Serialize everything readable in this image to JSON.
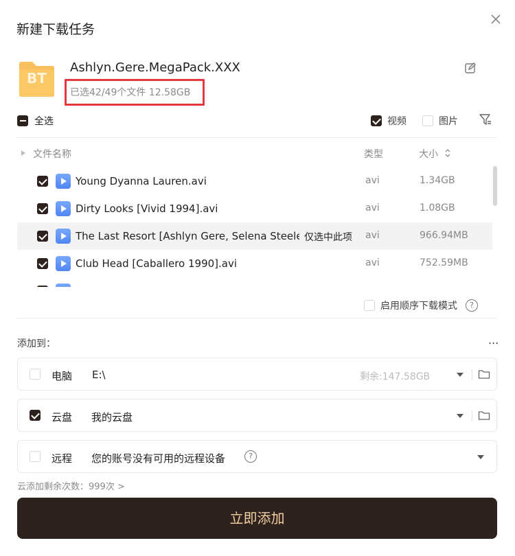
{
  "dialog": {
    "title": "新建下载任务"
  },
  "torrent": {
    "icon_label": "BT",
    "name": "Ashlyn.Gere.MegaPack.XXX",
    "selection_info": "已选42/49个文件 12.58GB",
    "colors": {
      "icon_bg": "#f7bf5e",
      "highlight_border": "#e5393f"
    }
  },
  "filters": {
    "select_all_label": "全选",
    "video_label": "视频",
    "video_checked": true,
    "image_label": "图片",
    "image_checked": false
  },
  "table": {
    "columns": {
      "name": "文件名称",
      "type": "类型",
      "size": "大小"
    },
    "only_select_label": "仅选中此项",
    "rows": [
      {
        "name": "Young Dyanna Lauren.avi",
        "type": "avi",
        "size": "1.34GB",
        "checked": true
      },
      {
        "name": "Dirty Looks [Vivid 1994].avi",
        "type": "avi",
        "size": "1.08GB",
        "checked": true
      },
      {
        "name": "The Last Resort [Ashlyn Gere, Selena Steele, L",
        "type": "avi",
        "size": "966.94MB",
        "checked": true
      },
      {
        "name": "Club Head [Caballero 1990].avi",
        "type": "avi",
        "size": "752.59MB",
        "checked": true
      },
      {
        "name": "",
        "type": "",
        "size": "",
        "checked": true
      }
    ]
  },
  "sequential": {
    "label": "启用顺序下载模式"
  },
  "destinations": {
    "title": "添加到：",
    "more_label": "...",
    "pc": {
      "label": "电脑",
      "path": "E:\\",
      "remaining": "剩余:147.58GB",
      "checked": false
    },
    "cloud": {
      "label": "云盘",
      "path": "我的云盘",
      "checked": true
    },
    "remote": {
      "label": "远程",
      "path": "您的账号没有可用的远程设备",
      "checked": false
    }
  },
  "footer": {
    "cloud_remaining": "云添加剩余次数：999次 >",
    "add_button": "立即添加",
    "colors": {
      "button_bg": "#2d221d",
      "button_text": "#f2cfa1"
    }
  }
}
